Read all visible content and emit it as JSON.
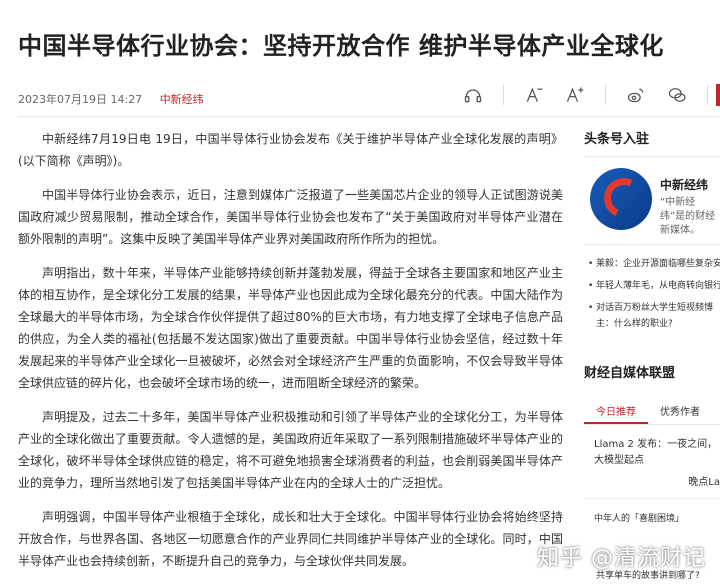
{
  "article": {
    "title": "中国半导体行业协会：坚持开放合作 维护半导体产业全球化",
    "date": "2023年07月19日 14:27",
    "source": "中新经纬",
    "paragraphs": [
      "中新经纬7月19日电 19日，中国半导体行业协会发布《关于维护半导体产业全球化发展的声明》(以下简称《声明》)。",
      "中国半导体行业协会表示，近日，注意到媒体广泛报道了一些美国芯片企业的领导人正试图游说美国政府减少贸易限制，推动全球合作，美国半导体行业协会也发布了“关于美国政府对半导体产业潜在额外限制的声明”。这集中反映了美国半导体产业界对美国政府所作所为的担忧。",
      "声明指出，数十年来，半导体产业能够持续创新并蓬勃发展，得益于全球各主要国家和地区产业主体的相互协作，是全球化分工发展的结果，半导体产业也因此成为全球化最充分的代表。中国大陆作为全球最大的半导体市场，为全球合作伙伴提供了超过80%的巨大市场，有力地支撑了全球电子信息产品的供应，为全人类的福祉(包括最不发达国家)做出了重要贡献。中国半导体行业协会坚信，经过数十年发展起来的半导体产业全球化一旦被破坏，必然会对全球经济产生严重的负面影响，不仅会导致半导体全球供应链的碎片化，也会破坏全球市场的统一，进而阻断全球经济的繁荣。",
      "声明提及，过去二十多年，美国半导体产业积极推动和引领了半导体产业的全球化分工，为半导体产业的全球化做出了重要贡献。令人遗憾的是，美国政府近年采取了一系列限制措施破坏半导体产业的全球化，破坏半导体全球供应链的稳定，将不可避免地损害全球消费者的利益，也会削弱美国半导体产业的竞争力，理所当然地引发了包括美国半导体产业在内的全球人士的广泛担忧。",
      "声明强调，中国半导体产业根植于全球化，成长和壮大于全球化。中国半导体行业协会将始终坚持开放合作，与世界各国、各地区一切愿意合作的产业界同仁共同维护半导体产业的全球化。同时，中国半导体产业也会持续创新，不断提升自己的竞争力，与全球伙伴共同发展。"
    ]
  },
  "toolbar": {
    "icons": [
      "headphones-icon",
      "font-decrease-icon",
      "font-increase-icon",
      "weibo-icon",
      "wechat-icon",
      "share-icon"
    ],
    "minus_glyph": "A",
    "plus_glyph": "A"
  },
  "sidebar": {
    "heading": "头条号入驻",
    "brand_name": "中新经纬",
    "brand_desc": "“中新经纬”是的财经新媒体。",
    "news": [
      "莱毅：企业开源面临哪些复杂安",
      "年轻人薄年毛，从电商转向银行",
      "对话百万粉丝大学生短视频博主：什么样的职业?"
    ]
  },
  "sidebar2": {
    "heading": "财经自媒体联盟",
    "tabs": [
      "今日推荐",
      "优秀作者"
    ],
    "active_tab": "今日推荐",
    "item_title": "Llama 2 发布：一夜之间，大模型起点",
    "item_source": "晚点La",
    "item2": "中年人的「喜剧困境」",
    "item3": "共享单车的故事讲到哪了?"
  },
  "watermark": "知乎 @清流财记",
  "colors": {
    "accent": "#c4232b"
  }
}
